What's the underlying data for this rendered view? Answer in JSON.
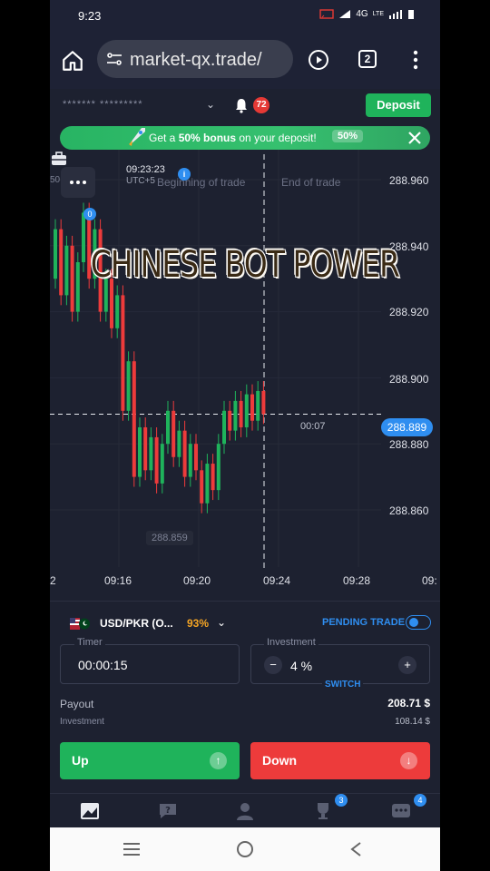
{
  "status_bar": {
    "time": "9:23",
    "network": "4G",
    "network_sub": "LTE"
  },
  "browser": {
    "url": "market-qx.trade/",
    "tab_count": "2"
  },
  "header": {
    "account_masked": "******* *********",
    "notification_count": "72",
    "deposit_label": "Deposit"
  },
  "bonus_banner": {
    "text_prefix": "Get a ",
    "bonus_bold": "50% bonus",
    "text_suffix": " on your deposit!",
    "percent": "50%"
  },
  "chart": {
    "trade_time": "09:23:23",
    "timezone": "UTC+5",
    "beginning_label": "Beginning of trade",
    "end_label": "End of trade",
    "left_edge": "50",
    "portfolio_count": "0",
    "info_marker": "i",
    "overlay_title": "CHINESE BOT POWER",
    "price_labels": [
      "288.960",
      "288.940",
      "288.920",
      "288.900",
      "288.880",
      "288.860"
    ],
    "current_price": "288.889",
    "countdown": "00:07",
    "min_price": "288.859",
    "time_labels": [
      "2",
      "09:16",
      "09:20",
      "09:24",
      "09:28",
      "09:"
    ]
  },
  "chart_data": {
    "type": "candlestick",
    "x_ticks": [
      "09:16",
      "09:20",
      "09:24",
      "09:28"
    ],
    "y_ticks": [
      288.86,
      288.88,
      288.9,
      288.92,
      288.94,
      288.96
    ],
    "current_price": 288.889,
    "colors": {
      "up": "#1fb35b",
      "down": "#ed3b3b",
      "grid": "#262a39",
      "background": "#1d2130"
    }
  },
  "trade_panel": {
    "asset": "USD/PKR (O...",
    "asset_payout": "93%",
    "pending_label": "PENDING TRADE",
    "timer_caption": "Timer",
    "timer_value": "00:00:15",
    "investment_caption": "Investment",
    "investment_value": "4 %",
    "minus": "−",
    "plus": "+",
    "switch_label": "SWITCH",
    "payout_label": "Payout",
    "payout_value": "208.71 $",
    "investment_label": "Investment",
    "investment_amount": "108.14 $",
    "up_label": "Up",
    "down_label": "Down",
    "up_arrow": "↑",
    "down_arrow": "↓"
  },
  "bottom_nav": {
    "trophy_badge": "3",
    "chat_badge": "4"
  },
  "icons": {
    "home": "home-icon",
    "tune": "tune-icon",
    "play": "play-icon",
    "tabs": "tabs-icon",
    "menu": "more-vert-icon",
    "bell": "bell-icon",
    "rocket": "rocket-icon",
    "close": "close-icon",
    "dots": "more-horiz-icon",
    "briefcase": "briefcase-icon",
    "flag": "flag-icon",
    "chevron": "chevron-down-icon",
    "chart": "chart-icon",
    "help": "help-icon",
    "user": "user-icon",
    "trophy": "trophy-icon",
    "chat": "chat-icon",
    "recents": "recents-icon",
    "home_sys": "home-circle-icon",
    "back": "back-icon"
  },
  "colors": {
    "background": "#1d2130",
    "accent_blue": "#2f8ef0",
    "green": "#1fb35b",
    "red": "#ed3b3b",
    "orange": "#f5a524"
  }
}
